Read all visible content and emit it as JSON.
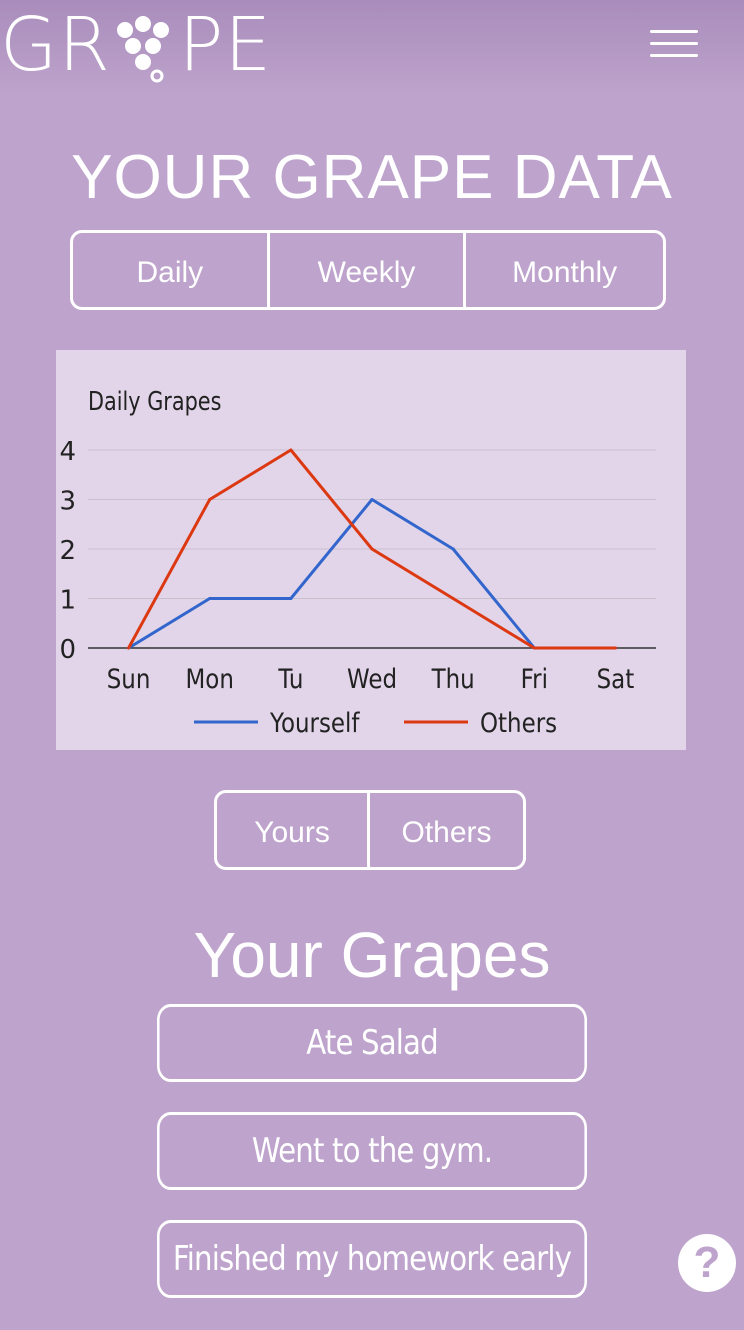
{
  "app": {
    "logo_left": "GR",
    "logo_right": "PE",
    "menu_icon": "hamburger-menu-icon"
  },
  "page_title": "YOUR GRAPE DATA",
  "period_tabs": [
    "Daily",
    "Weekly",
    "Monthly"
  ],
  "chart_data": {
    "type": "line",
    "title": "Daily Grapes",
    "categories": [
      "Sun",
      "Mon",
      "Tu",
      "Wed",
      "Thu",
      "Fri",
      "Sat"
    ],
    "ylim": [
      0,
      4
    ],
    "yticks": [
      0,
      1,
      2,
      3,
      4
    ],
    "grid": true,
    "legend_position": "bottom",
    "series": [
      {
        "name": "Yourself",
        "color": "#3366cc",
        "values": [
          0,
          1,
          1,
          3,
          2,
          0,
          0
        ]
      },
      {
        "name": "Others",
        "color": "#dc3912",
        "values": [
          0,
          3,
          4,
          2,
          1,
          0,
          0
        ]
      }
    ]
  },
  "who_tabs": [
    "Yours",
    "Others"
  ],
  "section_title": "Your Grapes",
  "grapes": [
    "Ate Salad",
    "Went to the gym.",
    "Finished my homework early"
  ],
  "help": {
    "label": "?",
    "icon": "help-icon"
  },
  "colors": {
    "background": "#bea4cc",
    "chart_bg": "#e2d5e9",
    "text": "#ffffff"
  }
}
